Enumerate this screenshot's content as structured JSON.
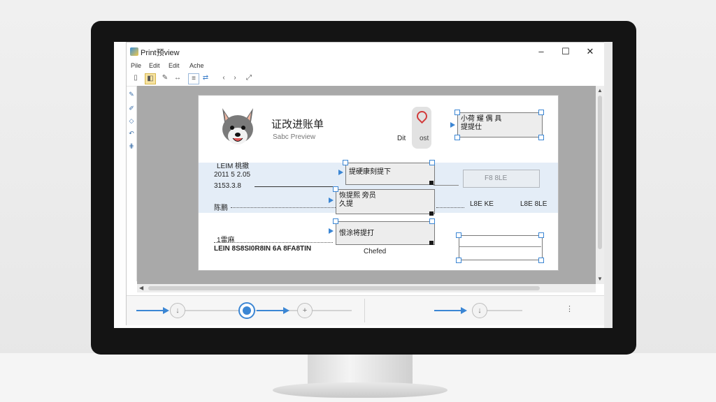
{
  "window": {
    "title": "Print预view",
    "minimize_glyph": "–",
    "maximize_glyph": "☐",
    "close_glyph": "✕"
  },
  "menu": [
    "Pile",
    "Edit",
    "Edit",
    "Ache"
  ],
  "toolbar_icons": [
    "open-icon",
    "print-icon",
    "pen-icon",
    "arrow-icon",
    "select-icon",
    "link-icon",
    "back-icon",
    "forward-icon",
    "resize-icon"
  ],
  "sidebar_icons": [
    "pen-icon",
    "brush-icon",
    "layers-icon",
    "undo-icon",
    "grid-icon"
  ],
  "document": {
    "title": "证改进账单",
    "subtitle": "Sabc Preview",
    "logo": "wolf-logo",
    "marker_label": "Dit",
    "marker_value": "ost",
    "left_lines": [
      "LEIM 桃撤",
      "2011 5 2.05",
      "3153.3.8",
      "陈鹏",
      "1雷麻",
      "LEIN 8S8SI0R8IN 6A 8FA8TIN"
    ],
    "footer_label": "Chefed",
    "center_fields": [
      "提硬康刻提下",
      "恢提熙 旁员\n久提",
      "恨涂将提打"
    ],
    "right_top_field": "小荷 耀 偶 具\n提提仕",
    "right_middle_label": "L8E  KE",
    "right_middle_value": "L8E 8LE",
    "right_faded_field": "F8 8LE"
  },
  "zoom": {
    "minus_glyph": "↓",
    "plus_glyph": "+",
    "dots": "⋮"
  }
}
